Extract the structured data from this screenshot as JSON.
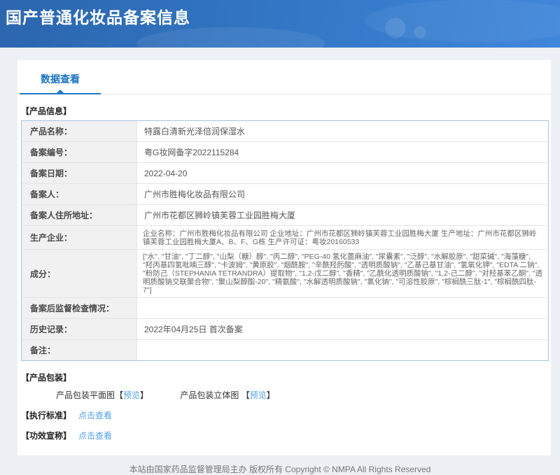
{
  "header": {
    "title": "国产普通化妆品备案信息"
  },
  "tabs": {
    "data_view": "数据查看"
  },
  "sections": {
    "product_info": "【产品信息】",
    "product_package": "【产品包装】",
    "exec_standard": "【执行标准】",
    "efficacy_claim": "【功效宣称】"
  },
  "table": {
    "rows": [
      {
        "label": "产品名称：",
        "value": "特露白清新光泽倍润保湿水"
      },
      {
        "label": "备案编号：",
        "value": "粤G妆网备字2022115284"
      },
      {
        "label": "备案日期：",
        "value": "2022-04-20"
      },
      {
        "label": "备案人：",
        "value": "广州市胜梅化妆品有限公司"
      },
      {
        "label": "备案人住所地址：",
        "value": "广州市花都区狮岭镇芙蓉工业园胜梅大厦"
      },
      {
        "label": "生产企业：",
        "value": "企业名称：广州市胜梅化妆品有限公司 企业地址：广州市花都区狮岭镇芙蓉工业园胜梅大厦 生产地址：广州市花都区狮岭镇芙蓉工业园胜梅大厦A、B、F、G栋 生产许可证：粤妆20160533"
      },
      {
        "label": "成分：",
        "value": "[\"水\", \"甘油\", \"丁二醇\", \"山梨（糖）醇\", \"丙二醇\", \"PEG-40 氢化蓖麻油\", \"尿囊素\", \"泛醇\", \"水解胶原\", \"甜菜碱\", \"海藻糖\", \"羟丙基四氢吡喃三醇\", \"卡波姆\", \"黄原胶\", \"烟酰胺\", \"辛酰羟肟酸\", \"透明质酸钠\", \"乙基己基甘油\", \"氢氧化钾\", \"EDTA 二钠\", \"粉防己（STEPHANIA TETRANDRA）提取物\", \"1,2-戊二醇\", \"香精\", \"乙酰化透明质酸钠\", \"1,2-己二醇\", \"对羟基苯乙酮\", \"透明质酸钠交联聚合物\", \"聚山梨醇酯-20\", \"精氨酸\", \"水解透明质酸钠\", \"氯化钠\", \"可溶性胶原\", \"棕榈酰三肽-1\", \"棕榈酰四肽-7\"]"
      },
      {
        "label": "备案后监督检查情况：",
        "value": ""
      },
      {
        "label": "历史记录：",
        "value": "2022年04月25日 首次备案"
      },
      {
        "label": "备注：",
        "value": ""
      }
    ]
  },
  "package": {
    "items": [
      {
        "label": "产品包装平面图",
        "bracket_open": "【",
        "link": "预览",
        "bracket_close": "】"
      },
      {
        "label": "产品包装立体图 ",
        "bracket_open": "【",
        "link": "预览",
        "bracket_close": "】"
      }
    ]
  },
  "links": {
    "click_view": "点击查看"
  },
  "colors": {
    "header_blue_start": "#2b66ae",
    "header_blue_end": "#4087da",
    "tab_blue": "#1873c4",
    "table_border_blue": "#a5c3e2",
    "link_blue": "#54a0e6"
  },
  "footer": {
    "text": "本站由国家药品监督管理局主办 版权所有 Copyright © NMPA All Rights Reserved"
  }
}
